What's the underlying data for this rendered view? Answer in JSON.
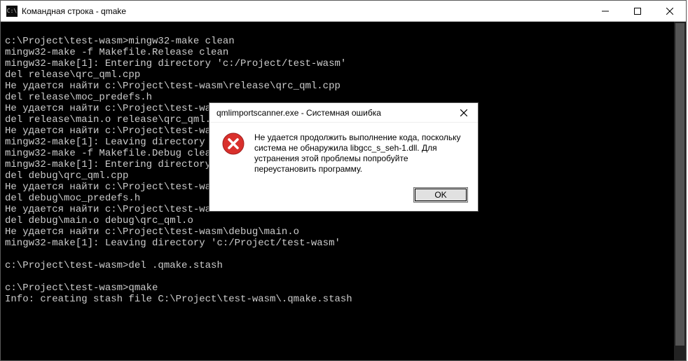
{
  "window": {
    "title": "Командная строка - qmake",
    "icon_label": "C:\\"
  },
  "terminal_lines": [
    "",
    "c:\\Project\\test-wasm>mingw32-make clean",
    "mingw32-make -f Makefile.Release clean",
    "mingw32-make[1]: Entering directory 'c:/Project/test-wasm'",
    "del release\\qrc_qml.cpp",
    "Не удается найти c:\\Project\\test-wasm\\release\\qrc_qml.cpp",
    "del release\\moc_predefs.h",
    "Не удается найти c:\\Project\\test-wa",
    "del release\\main.o release\\qrc_qml.",
    "Не удается найти c:\\Project\\test-wa",
    "mingw32-make[1]: Leaving directory ",
    "mingw32-make -f Makefile.Debug clea",
    "mingw32-make[1]: Entering directory",
    "del debug\\qrc_qml.cpp",
    "Не удается найти c:\\Project\\test-wa",
    "del debug\\moc_predefs.h",
    "Не удается найти c:\\Project\\test-wa",
    "del debug\\main.o debug\\qrc_qml.o",
    "Не удается найти c:\\Project\\test-wasm\\debug\\main.o",
    "mingw32-make[1]: Leaving directory 'c:/Project/test-wasm'",
    "",
    "c:\\Project\\test-wasm>del .qmake.stash",
    "",
    "c:\\Project\\test-wasm>qmake",
    "Info: creating stash file C:\\Project\\test-wasm\\.qmake.stash"
  ],
  "dialog": {
    "title": "qmlimportscanner.exe - Системная ошибка",
    "icon_name": "error-icon",
    "message": "Не удается продолжить выполнение кода, поскольку система не обнаружила libgcc_s_seh-1.dll. Для устранения этой проблемы попробуйте переустановить программу.",
    "ok_label": "OK"
  }
}
